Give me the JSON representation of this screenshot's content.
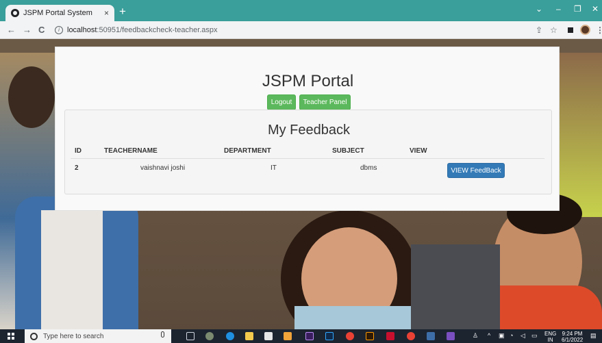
{
  "browser": {
    "tab_title": "JSPM Portal System",
    "tab_close": "×",
    "new_tab": "+",
    "url_host": "localhost",
    "url_path": ":50951/feedbackcheck-teacher.aspx",
    "back": "←",
    "forward": "→",
    "reload": "C",
    "minimize": "–",
    "restore": "❐",
    "close": "✕",
    "dropdown": "⌄"
  },
  "portal": {
    "title": "JSPM Portal",
    "logout_label": "Logout",
    "teacher_panel_label": "Teacher Panel"
  },
  "feedback": {
    "heading": "My Feedback",
    "columns": [
      "ID",
      "TEACHERNAME",
      "DEPARTMENT",
      "SUBJECT",
      "VIEW"
    ],
    "rows": [
      {
        "id": "2",
        "teacher": "vaishnavi joshi",
        "department": "IT",
        "subject": "dbms",
        "action": "VIEW FeedBack"
      }
    ]
  },
  "taskbar": {
    "search_placeholder": "Type here to search",
    "lang": "ENG",
    "lang_sub": "IN",
    "time": "9:24 PM",
    "date": "6/1/2022"
  },
  "colors": {
    "tabbar": "#3a9e9a",
    "success": "#5cb85c",
    "primary": "#337ab7",
    "taskbar": "#1c2430"
  }
}
